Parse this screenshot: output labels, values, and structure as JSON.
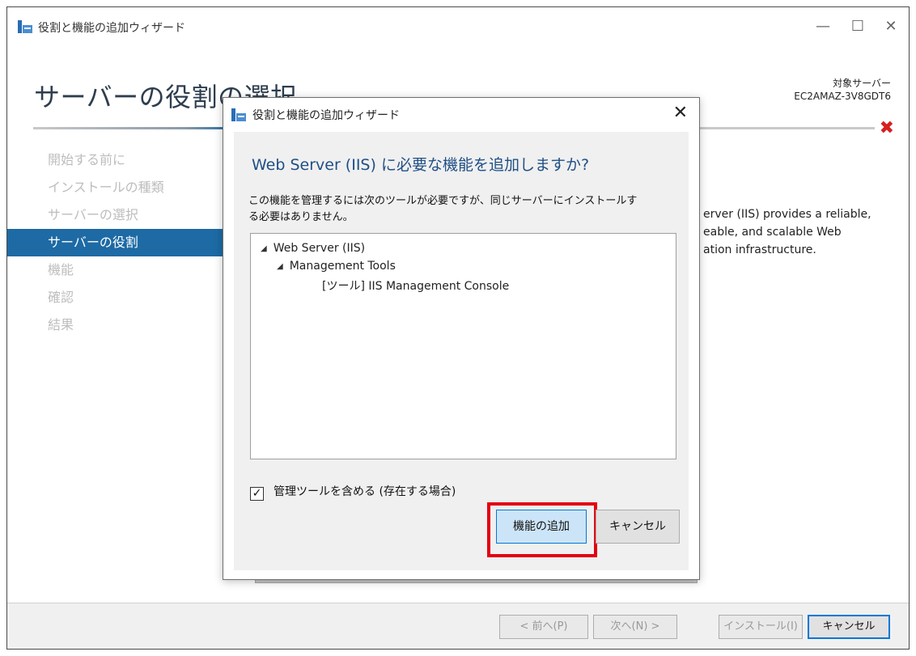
{
  "window": {
    "title": "役割と機能の追加ウィザード",
    "minimize": "—",
    "maximize": "☐",
    "close": "✕"
  },
  "header": {
    "title": "サーバーの役割の選択",
    "target_label": "対象サーバー",
    "target_name": "EC2AMAZ-3V8GDT6",
    "close_mark": "✖"
  },
  "nav": {
    "items": [
      {
        "label": "開始する前に"
      },
      {
        "label": "インストールの種類"
      },
      {
        "label": "サーバーの選択"
      },
      {
        "label": "サーバーの役割"
      },
      {
        "label": "機能"
      },
      {
        "label": "確認"
      },
      {
        "label": "結果"
      }
    ],
    "active_index": 3
  },
  "description": {
    "line1": "erver (IIS) provides a reliable,",
    "line2": "eable, and scalable Web",
    "line3": "ation infrastructure."
  },
  "footer": {
    "prev": "< 前へ(P)",
    "next": "次へ(N) >",
    "install": "インストール(I)",
    "cancel": "キャンセル"
  },
  "dialog": {
    "title": "役割と機能の追加ウィザード",
    "close": "✕",
    "heading": "Web Server (IIS) に必要な機能を追加しますか?",
    "text_line1": "この機能を管理するには次のツールが必要ですが、同じサーバーにインストールす",
    "text_line2": "る必要はありません。",
    "tree": [
      {
        "arrow": "◢",
        "label": "Web Server (IIS)"
      },
      {
        "arrow": "◢",
        "label": "Management Tools"
      },
      {
        "arrow": "",
        "label": "[ツール] IIS Management Console"
      }
    ],
    "checkbox_label": "管理ツールを含める (存在する場合)",
    "checkbox_checked": true,
    "checkbox_mark": "✓",
    "add_button": "機能の追加",
    "cancel_button": "キャンセル"
  }
}
